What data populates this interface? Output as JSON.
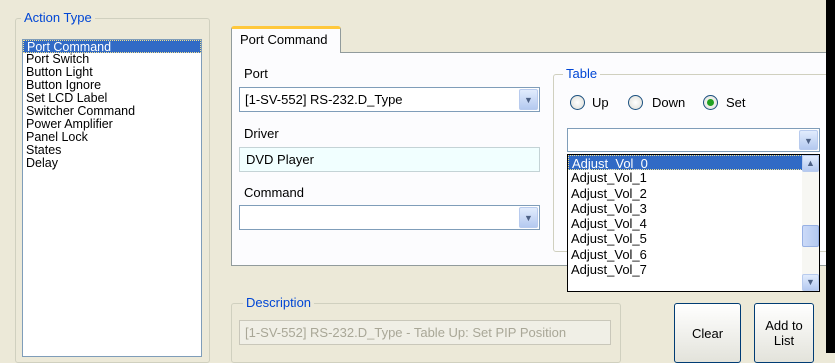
{
  "action_type": {
    "legend": "Action Type",
    "items": [
      "Port Command",
      "Port Switch",
      "Button Light",
      "Button Ignore",
      "Set LCD Label",
      "Switcher Command",
      "Power Amplifier",
      "Panel Lock",
      "States",
      "Delay"
    ],
    "selected": "Port Command"
  },
  "tab": {
    "label": "Port Command"
  },
  "port": {
    "label": "Port",
    "value": "[1-SV-552] RS-232.D_Type"
  },
  "driver": {
    "label": "Driver",
    "value": "DVD Player"
  },
  "command": {
    "label": "Command",
    "value": ""
  },
  "table": {
    "legend": "Table",
    "options": [
      "Up",
      "Down",
      "Set"
    ],
    "selected": "Set",
    "value": "",
    "list_items": [
      "Adjust_Vol_0",
      "Adjust_Vol_1",
      "Adjust_Vol_2",
      "Adjust_Vol_3",
      "Adjust_Vol_4",
      "Adjust_Vol_5",
      "Adjust_Vol_6",
      "Adjust_Vol_7"
    ],
    "list_selected": "Adjust_Vol_0"
  },
  "description": {
    "legend": "Description",
    "value": "[1-SV-552] RS-232.D_Type - Table Up: Set PIP Position"
  },
  "buttons": {
    "clear": "Clear",
    "add_to_list": "Add to List"
  },
  "icons": {
    "dropdown": "chevron-down-icon",
    "scroll_up": "chevron-up-icon",
    "scroll_down": "chevron-down-icon"
  }
}
